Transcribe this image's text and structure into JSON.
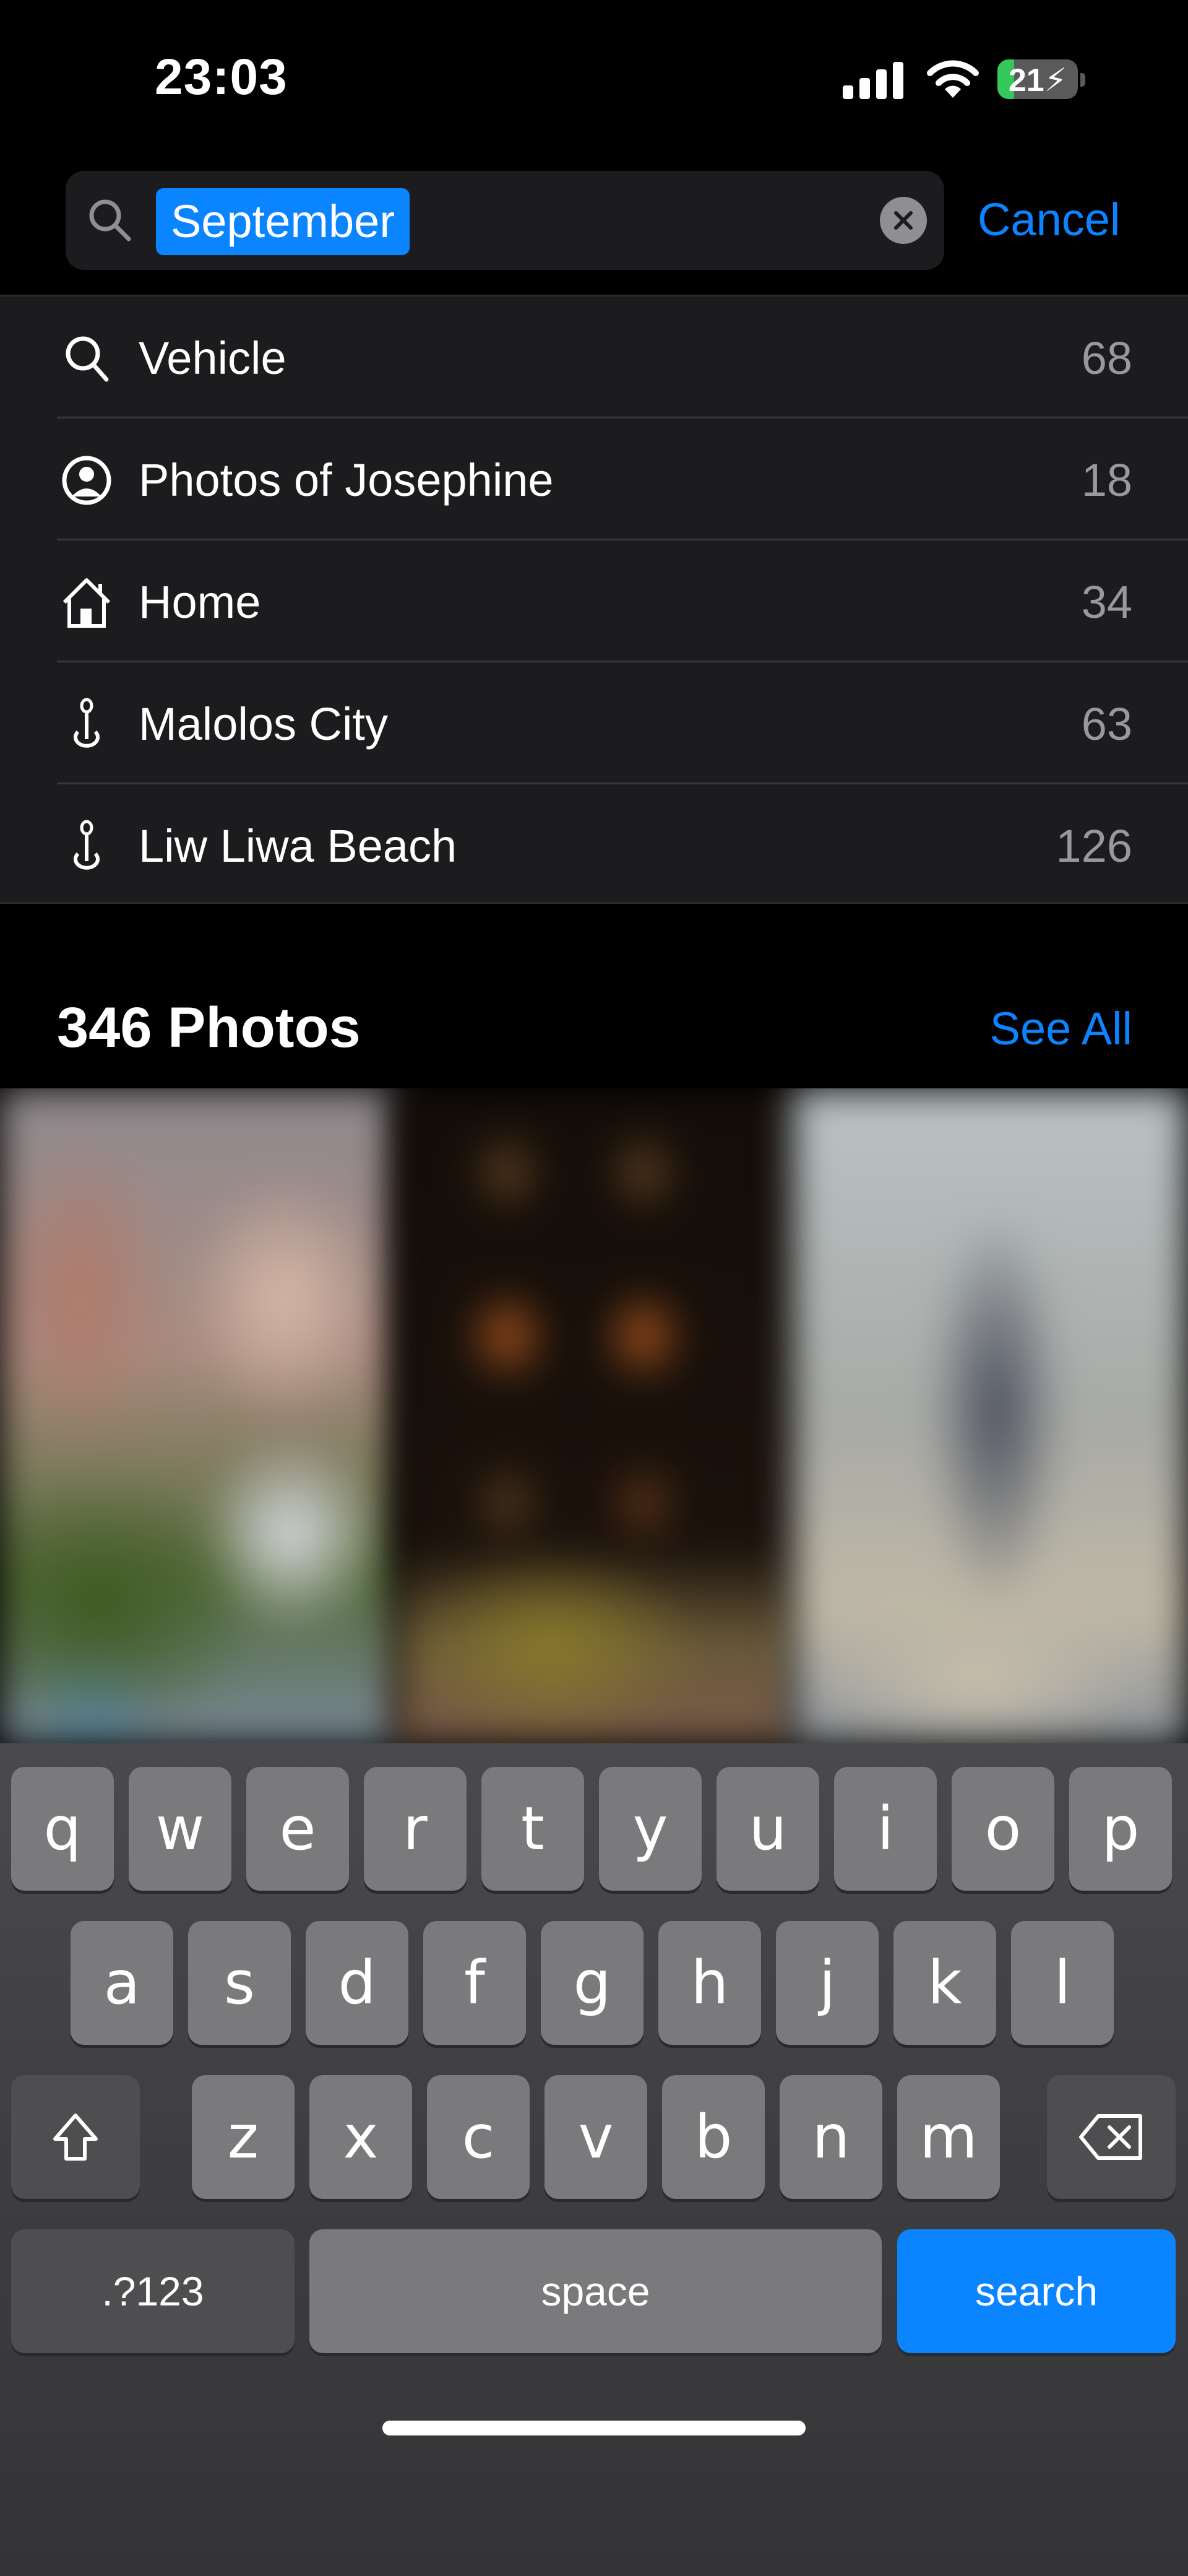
{
  "status_bar": {
    "time": "23:03",
    "signal_icon": "cellular-signal-icon",
    "signal_bars": 4,
    "wifi_icon": "wifi-icon",
    "battery_percent": 21,
    "battery_label": "21",
    "battery_charging": true,
    "battery_color": "#34c759"
  },
  "search": {
    "query": "September",
    "query_selected": true,
    "search_icon": "search-icon",
    "clear_icon": "clear-icon",
    "cancel_label": "Cancel",
    "accent_color": "#0a84ff"
  },
  "suggestions": [
    {
      "icon": "search-icon",
      "label": "Vehicle",
      "count": "68"
    },
    {
      "icon": "person-circle-icon",
      "label": "Photos of Josephine",
      "count": "18"
    },
    {
      "icon": "home-icon",
      "label": "Home",
      "count": "34"
    },
    {
      "icon": "location-pin-icon",
      "label": "Malolos City",
      "count": "63"
    },
    {
      "icon": "location-pin-icon",
      "label": "Liw Liwa Beach",
      "count": "126"
    }
  ],
  "photos_section": {
    "title": "346 Photos",
    "see_all_label": "See All",
    "thumbnails": [
      "photo-1",
      "photo-2",
      "photo-3"
    ]
  },
  "keyboard": {
    "row1": [
      "q",
      "w",
      "e",
      "r",
      "t",
      "y",
      "u",
      "i",
      "o",
      "p"
    ],
    "row2": [
      "a",
      "s",
      "d",
      "f",
      "g",
      "h",
      "j",
      "k",
      "l"
    ],
    "row3": [
      "z",
      "x",
      "c",
      "v",
      "b",
      "n",
      "m"
    ],
    "shift_icon": "shift-icon",
    "delete_icon": "backspace-icon",
    "numbers_label": ".?123",
    "space_label": "space",
    "return_label": "search"
  }
}
